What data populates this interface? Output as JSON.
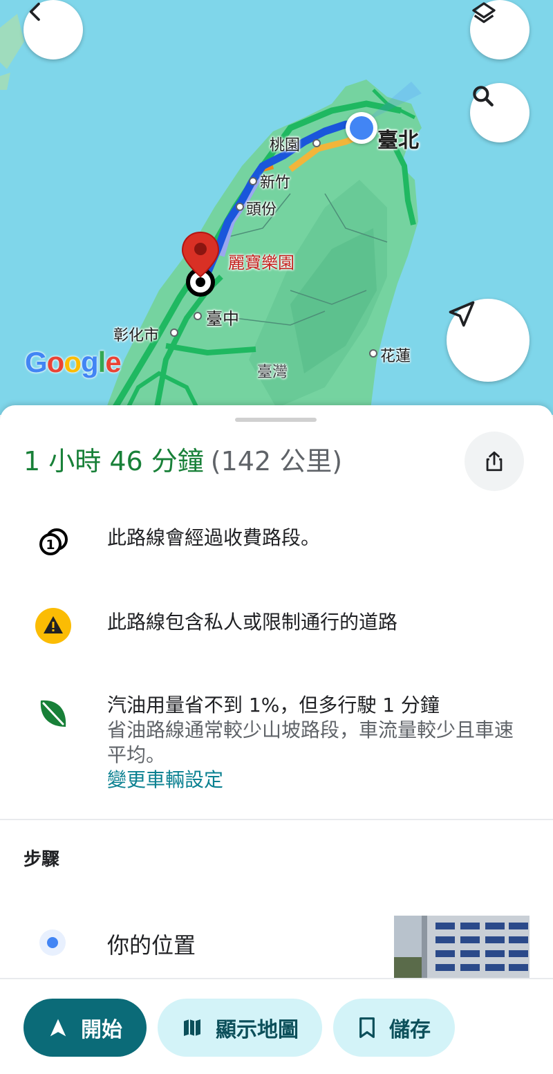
{
  "map": {
    "labels": {
      "taipei": "臺北",
      "taoyuan": "桃園",
      "hsinchu": "新竹",
      "toufen": "頭份",
      "destination": "麗寶樂園",
      "taichung": "臺中",
      "changhua": "彰化市",
      "hualien": "花蓮",
      "taiwan": "臺灣"
    },
    "logo": "Google"
  },
  "route": {
    "duration": "1 小時 46 分鐘",
    "distance": "(142 公里)"
  },
  "info": {
    "toll": "此路線會經過收費路段。",
    "restricted": "此路線包含私人或限制通行的道路",
    "eco_main": "汽油用量省不到 1%，但多行駛 1 分鐘",
    "eco_sub": "省油路線通常較少山坡路段，車流量較少且車速平均。",
    "eco_link": "變更車輛設定"
  },
  "steps": {
    "title": "步驟",
    "first": "你的位置"
  },
  "actions": {
    "start": "開始",
    "show_map": "顯示地圖",
    "save": "儲存"
  },
  "colors": {
    "duration": "#188038",
    "start_button": "#0b6b78",
    "secondary_button": "#d3f3f8",
    "link": "#0b8191",
    "route": "#1a56db",
    "route_alt": "#9aa8f0",
    "map_water": "#7fd6ea",
    "map_land": "#75d3a0"
  }
}
